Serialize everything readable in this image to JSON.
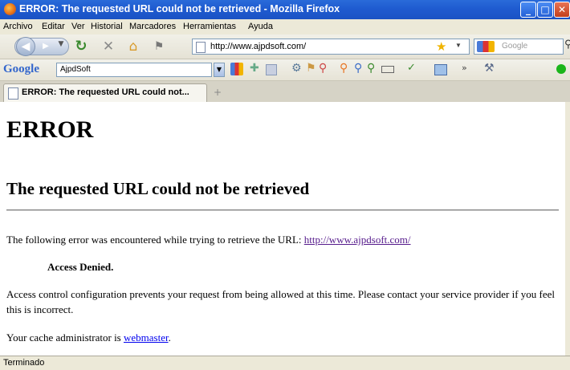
{
  "window": {
    "title": "ERROR: The requested URL could not be retrieved - Mozilla Firefox",
    "minimize_glyph": "_",
    "maximize_glyph": "□",
    "close_glyph": "✕"
  },
  "menu": [
    "Archivo",
    "Editar",
    "Ver",
    "Historial",
    "Marcadores",
    "Herramientas",
    "Ayuda"
  ],
  "navbar": {
    "url": "http://www.ajpdsoft.com/",
    "search_engine_placeholder": "Google"
  },
  "googlebar": {
    "logo": "Google",
    "search_value": "AjpdSoft"
  },
  "tabs": [
    {
      "label": "ERROR: The requested URL could not..."
    }
  ],
  "new_tab_glyph": "+",
  "page": {
    "heading": "ERROR",
    "subheading": "The requested URL could not be retrieved",
    "error_intro": "The following error was encountered while trying to retrieve the URL: ",
    "error_url": "http://www.ajpdsoft.com/",
    "access_denied": "Access Denied.",
    "explanation": "Access control configuration prevents your request from being allowed at this time. Please contact your service provider if you feel this is incorrect.",
    "cache_admin_prefix": "Your cache administrator is ",
    "cache_admin_link": "webmaster",
    "cache_admin_suffix": "."
  },
  "status": {
    "text": "Terminado"
  },
  "colors": {
    "titlebar": "#1f5bd0",
    "chrome": "#ece9d8",
    "visited_link": "#551a8b",
    "link": "#0000ee"
  }
}
